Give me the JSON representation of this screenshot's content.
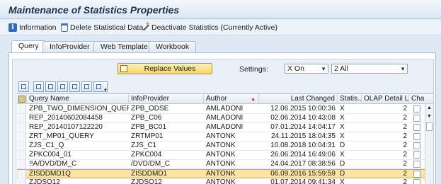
{
  "window": {
    "title": "Maintenance of Statistics Properties"
  },
  "toolbar": {
    "information_label": "Information",
    "delete_label": "Delete Statistical Data",
    "deactivate_label": "Deactivate Statistics (Currently Active)",
    "information_icon": "info-icon",
    "delete_icon": "trash-icon",
    "deactivate_icon": "wand-icon"
  },
  "tabs": [
    {
      "label": "Query",
      "active": true
    },
    {
      "label": "InfoProvider",
      "active": false
    },
    {
      "label": "Web Template",
      "active": false
    },
    {
      "label": "Workbook",
      "active": false
    }
  ],
  "controls": {
    "replace_label": "Replace Values",
    "settings_label": "Settings:",
    "settings_value_1": "X On",
    "settings_value_2": "2 All"
  },
  "table": {
    "columns": [
      "Query Name",
      "InfoProvider",
      "Author",
      "Last Changed",
      "Statis...",
      "OLAP Detail Le...",
      "Chang"
    ],
    "sorted_column": "Author",
    "rows": [
      {
        "query": "ZPB_TWO_DIMENSION_QUERY",
        "provider": "ZPB_ODSE",
        "author": "AMLADONI",
        "changed": "12.06.2015 10:00:36",
        "stat": "X",
        "olap": "2",
        "highlight": false
      },
      {
        "query": "REP_20140602084458",
        "provider": "ZPB_C06",
        "author": "AMLADONI",
        "changed": "02.06.2014 10:43:08",
        "stat": "X",
        "olap": "2",
        "highlight": false
      },
      {
        "query": "REP_20140107122220",
        "provider": "ZPB_BC01",
        "author": "AMLADONI",
        "changed": "07.01.2014 14:04:17",
        "stat": "X",
        "olap": "2",
        "highlight": false
      },
      {
        "query": "ZRT_MP01_QUERY",
        "provider": "ZRTMP01",
        "author": "ANTONK",
        "changed": "24.11.2015 18:04:35",
        "stat": "X",
        "olap": "2",
        "highlight": false
      },
      {
        "query": "ZJS_C1_Q",
        "provider": "ZJS_C1",
        "author": "ANTONK",
        "changed": "10.08.2018 10:04:31",
        "stat": "D",
        "olap": "2",
        "highlight": false
      },
      {
        "query": "ZPKC004_01",
        "provider": "ZPKC004",
        "author": "ANTONK",
        "changed": "26.06.2014 16:49:06",
        "stat": "X",
        "olap": "2",
        "highlight": false
      },
      {
        "query": "!!A/DVD/DM_C",
        "provider": "/DVD/DM_C",
        "author": "ANTONK",
        "changed": "24.04.2017 08:38:56",
        "stat": "D",
        "olap": "2",
        "highlight": false
      },
      {
        "query": "ZISDDMD1Q",
        "provider": "ZISDDMD1",
        "author": "ANTONK",
        "changed": "06.09.2016 15:59:59",
        "stat": "D",
        "olap": "2",
        "highlight": true
      },
      {
        "query": "ZJDSO12",
        "provider": "ZJDSO12",
        "author": "ANTONK",
        "changed": "01.07.2014 09:41:34",
        "stat": "X",
        "olap": "2",
        "highlight": false
      }
    ]
  },
  "colors": {
    "highlight_row": "#fde4a0",
    "replace_button": "#f7d66a",
    "title_text": "#1b2f4a"
  }
}
